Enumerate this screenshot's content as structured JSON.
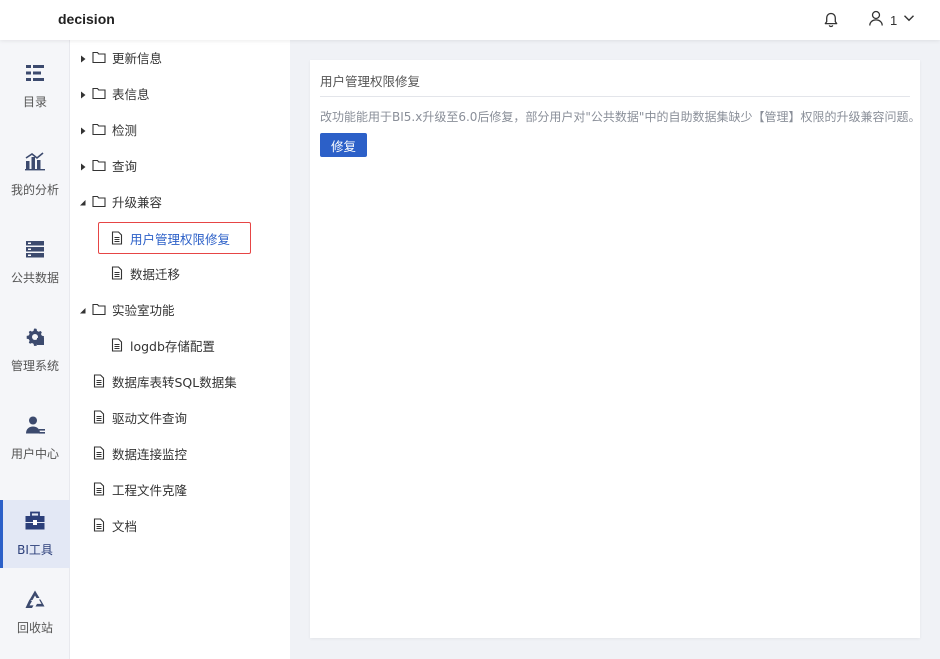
{
  "app": {
    "title": "decision"
  },
  "header": {
    "user_name": "1"
  },
  "sidebar": {
    "items": [
      {
        "label": "目录",
        "icon": "catalog-icon"
      },
      {
        "label": "我的分析",
        "icon": "chart-icon"
      },
      {
        "label": "公共数据",
        "icon": "database-icon"
      },
      {
        "label": "管理系统",
        "icon": "gear-icon"
      },
      {
        "label": "用户中心",
        "icon": "user-icon"
      },
      {
        "label": "BI工具",
        "icon": "toolbox-icon",
        "active": true
      },
      {
        "label": "回收站",
        "icon": "recycle-icon"
      }
    ]
  },
  "tree": {
    "items": [
      {
        "label": "更新信息",
        "type": "folder",
        "expanded": false
      },
      {
        "label": "表信息",
        "type": "folder",
        "expanded": false
      },
      {
        "label": "检测",
        "type": "folder",
        "expanded": false
      },
      {
        "label": "查询",
        "type": "folder",
        "expanded": false
      },
      {
        "label": "升级兼容",
        "type": "folder",
        "expanded": true
      },
      {
        "label": "用户管理权限修复",
        "type": "file",
        "selected": true
      },
      {
        "label": "数据迁移",
        "type": "file"
      },
      {
        "label": "实验室功能",
        "type": "folder",
        "expanded": true
      },
      {
        "label": "logdb存储配置",
        "type": "file"
      },
      {
        "label": "数据库表转SQL数据集",
        "type": "file"
      },
      {
        "label": "驱动文件查询",
        "type": "file"
      },
      {
        "label": "数据连接监控",
        "type": "file"
      },
      {
        "label": "工程文件克隆",
        "type": "file"
      },
      {
        "label": "文档",
        "type": "file"
      }
    ]
  },
  "panel": {
    "title": "用户管理权限修复",
    "description": "改功能能用于BI5.x升级至6.0后修复，部分用户对\"公共数据\"中的自助数据集缺少【管理】权限的升级兼容问题。",
    "fix_button": "修复"
  },
  "colors": {
    "accent": "#2c60c8",
    "highlight_border": "#e64545"
  }
}
